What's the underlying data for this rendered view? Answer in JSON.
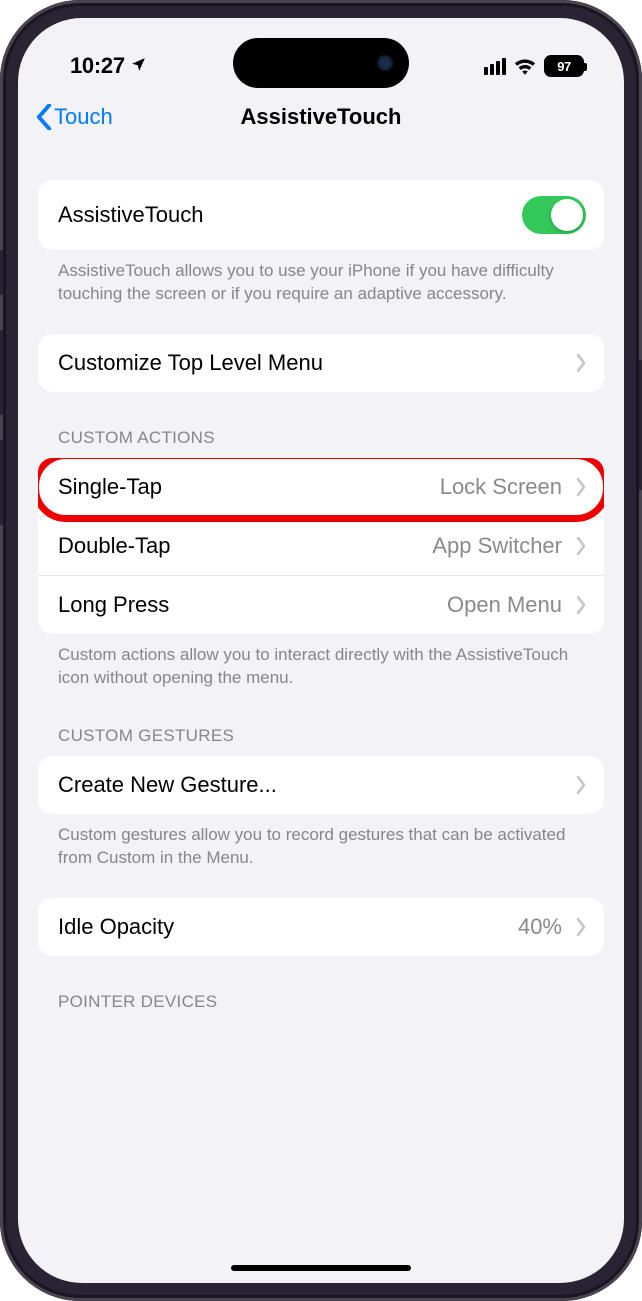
{
  "status": {
    "time": "10:27",
    "battery": "97"
  },
  "nav": {
    "back_label": "Touch",
    "title": "AssistiveTouch"
  },
  "main_toggle": {
    "label": "AssistiveTouch",
    "footer": "AssistiveTouch allows you to use your iPhone if you have difficulty touching the screen or if you require an adaptive accessory."
  },
  "customize_menu": {
    "label": "Customize Top Level Menu"
  },
  "custom_actions": {
    "header": "CUSTOM ACTIONS",
    "rows": [
      {
        "label": "Single-Tap",
        "value": "Lock Screen"
      },
      {
        "label": "Double-Tap",
        "value": "App Switcher"
      },
      {
        "label": "Long Press",
        "value": "Open Menu"
      }
    ],
    "footer": "Custom actions allow you to interact directly with the AssistiveTouch icon without opening the menu."
  },
  "custom_gestures": {
    "header": "CUSTOM GESTURES",
    "label": "Create New Gesture...",
    "footer": "Custom gestures allow you to record gestures that can be activated from Custom in the Menu."
  },
  "idle_opacity": {
    "label": "Idle Opacity",
    "value": "40%"
  },
  "pointer_devices": {
    "header": "POINTER DEVICES"
  }
}
